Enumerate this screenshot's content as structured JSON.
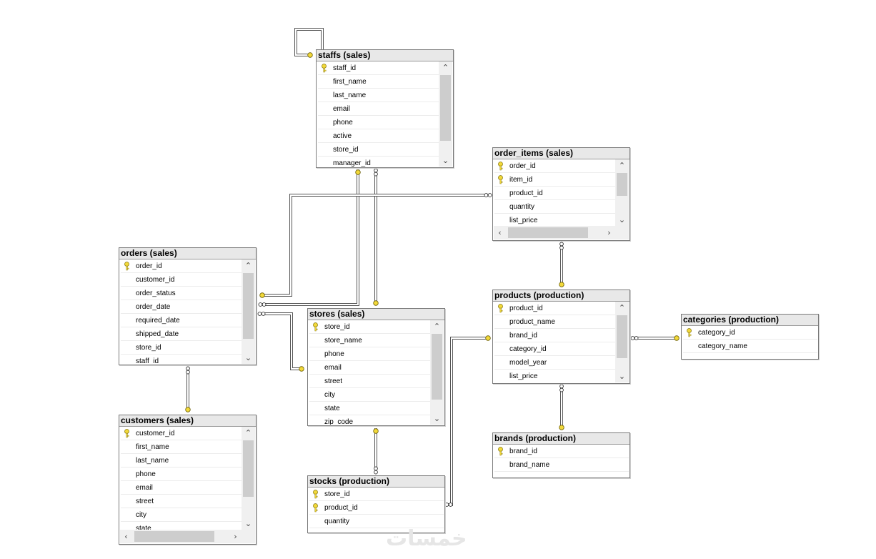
{
  "tables": [
    {
      "id": "staffs",
      "title": "staffs (sales)",
      "columns": [
        {
          "name": "staff_id",
          "key": true
        },
        {
          "name": "first_name"
        },
        {
          "name": "last_name"
        },
        {
          "name": "email"
        },
        {
          "name": "phone"
        },
        {
          "name": "active"
        },
        {
          "name": "store_id"
        },
        {
          "name": "manager_id"
        }
      ]
    },
    {
      "id": "order_items",
      "title": "order_items (sales)",
      "columns": [
        {
          "name": "order_id",
          "key": true
        },
        {
          "name": "item_id",
          "key": true
        },
        {
          "name": "product_id"
        },
        {
          "name": "quantity"
        },
        {
          "name": "list_price"
        }
      ]
    },
    {
      "id": "orders",
      "title": "orders (sales)",
      "columns": [
        {
          "name": "order_id",
          "key": true
        },
        {
          "name": "customer_id"
        },
        {
          "name": "order_status"
        },
        {
          "name": "order_date"
        },
        {
          "name": "required_date"
        },
        {
          "name": "shipped_date"
        },
        {
          "name": "store_id"
        },
        {
          "name": "staff_id"
        }
      ]
    },
    {
      "id": "stores",
      "title": "stores (sales)",
      "columns": [
        {
          "name": "store_id",
          "key": true
        },
        {
          "name": "store_name"
        },
        {
          "name": "phone"
        },
        {
          "name": "email"
        },
        {
          "name": "street"
        },
        {
          "name": "city"
        },
        {
          "name": "state"
        },
        {
          "name": "zip_code"
        }
      ]
    },
    {
      "id": "products",
      "title": "products (production)",
      "columns": [
        {
          "name": "product_id",
          "key": true
        },
        {
          "name": "product_name"
        },
        {
          "name": "brand_id"
        },
        {
          "name": "category_id"
        },
        {
          "name": "model_year"
        },
        {
          "name": "list_price"
        }
      ]
    },
    {
      "id": "categories",
      "title": "categories (production)",
      "columns": [
        {
          "name": "category_id",
          "key": true
        },
        {
          "name": "category_name"
        }
      ]
    },
    {
      "id": "customers",
      "title": "customers (sales)",
      "columns": [
        {
          "name": "customer_id",
          "key": true
        },
        {
          "name": "first_name"
        },
        {
          "name": "last_name"
        },
        {
          "name": "phone"
        },
        {
          "name": "email"
        },
        {
          "name": "street"
        },
        {
          "name": "city"
        },
        {
          "name": "state"
        }
      ]
    },
    {
      "id": "brands",
      "title": "brands (production)",
      "columns": [
        {
          "name": "brand_id",
          "key": true
        },
        {
          "name": "brand_name"
        }
      ]
    },
    {
      "id": "stocks",
      "title": "stocks (production)",
      "columns": [
        {
          "name": "store_id",
          "key": true
        },
        {
          "name": "product_id",
          "key": true
        },
        {
          "name": "quantity"
        }
      ]
    }
  ],
  "colors": {
    "key": "#f2d93a",
    "line": "#555555"
  },
  "watermark": "خمسات"
}
